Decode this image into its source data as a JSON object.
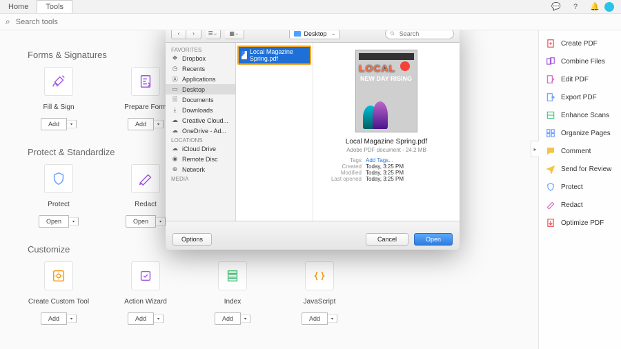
{
  "colors": {
    "accent_purple": "#a259e4",
    "accent_blue": "#6a9fff",
    "accent_orange": "#f59b13",
    "accent_green": "#4cc57c",
    "accent_red": "#e6484e"
  },
  "topbar": {
    "home": "Home",
    "tools": "Tools"
  },
  "search": {
    "placeholder": "Search tools"
  },
  "sections": {
    "forms": {
      "title": "Forms & Signatures",
      "tools": [
        {
          "label": "Fill & Sign",
          "btn": "Add"
        },
        {
          "label": "Prepare Form",
          "btn": "Add"
        }
      ]
    },
    "protect": {
      "title": "Protect & Standardize",
      "tools": [
        {
          "label": "Protect",
          "btn": "Open"
        },
        {
          "label": "Redact",
          "btn": "Open"
        }
      ]
    },
    "customize": {
      "title": "Customize",
      "tools": [
        {
          "label": "Create Custom Tool",
          "btn": "Add"
        },
        {
          "label": "Action Wizard",
          "btn": "Add"
        },
        {
          "label": "Index",
          "btn": "Add"
        },
        {
          "label": "JavaScript",
          "btn": "Add"
        }
      ]
    }
  },
  "right_rail": [
    "Create PDF",
    "Combine Files",
    "Edit PDF",
    "Export PDF",
    "Enhance Scans",
    "Organize Pages",
    "Comment",
    "Send for Review",
    "Protect",
    "Redact",
    "Optimize PDF"
  ],
  "dialog": {
    "location_dropdown": "Desktop",
    "search_placeholder": "Search",
    "sidebar": {
      "favorites": {
        "header": "Favorites",
        "items": [
          "Dropbox",
          "Recents",
          "Applications",
          "Desktop",
          "Documents",
          "Downloads",
          "Creative Cloud...",
          "OneDrive - Ad..."
        ]
      },
      "locations": {
        "header": "Locations",
        "items": [
          "iCloud Drive",
          "Remote Disc",
          "Network"
        ]
      },
      "media": {
        "header": "Media"
      }
    },
    "selected_file": "Local Magazine Spring.pdf",
    "preview": {
      "image_text_local": "LOCAL",
      "image_text_rising": "NEW DAY\nRISING",
      "name": "Local Magazine Spring.pdf",
      "meta": "Adobe PDF document - 24.2 MB",
      "rows": [
        {
          "k": "Tags",
          "v": "Add Tags...",
          "link": true
        },
        {
          "k": "Created",
          "v": "Today, 3:25 PM"
        },
        {
          "k": "Modified",
          "v": "Today, 3:25 PM"
        },
        {
          "k": "Last opened",
          "v": "Today, 3:25 PM"
        }
      ]
    },
    "footer": {
      "options": "Options",
      "cancel": "Cancel",
      "open": "Open"
    }
  }
}
